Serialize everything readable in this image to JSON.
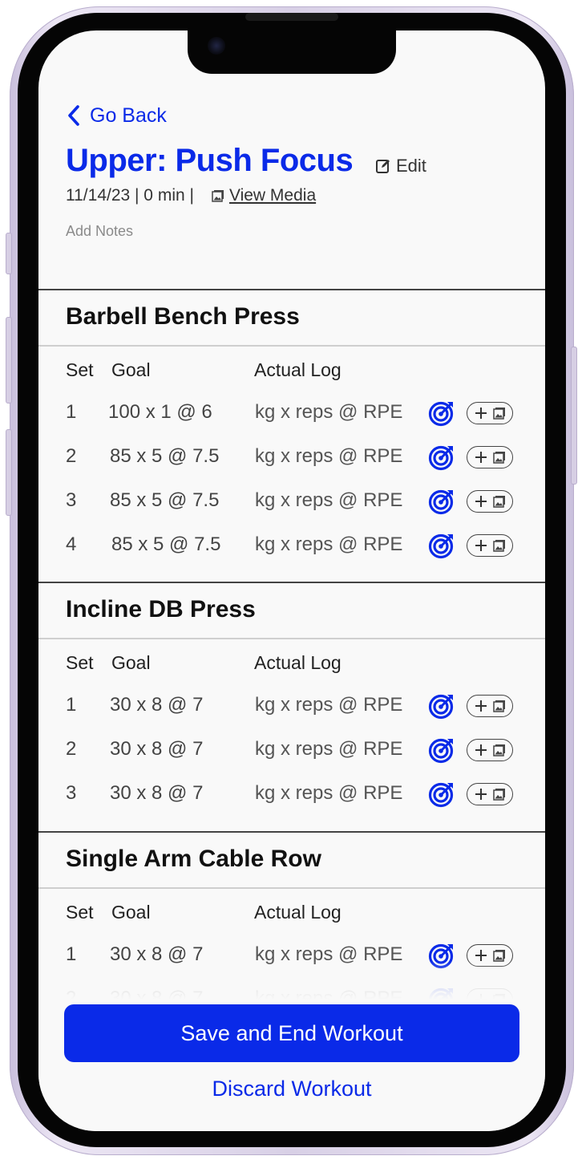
{
  "header": {
    "back_label": "Go Back",
    "title": "Upper: Push Focus",
    "edit_label": "Edit",
    "meta": "11/14/23 | 0 min |",
    "view_media_label": "View Media",
    "notes_placeholder": "Add Notes"
  },
  "columns": {
    "set": "Set",
    "goal": "Goal",
    "actual": "Actual Log"
  },
  "actual_placeholder": "kg x reps @ RPE",
  "exercises": [
    {
      "name": "Barbell Bench Press",
      "sets": [
        {
          "set": "1",
          "goal": "100 x 1 @ 6"
        },
        {
          "set": "2",
          "goal": "85 x 5 @ 7.5"
        },
        {
          "set": "3",
          "goal": "85 x 5 @ 7.5"
        },
        {
          "set": "4",
          "goal": "85 x 5 @ 7.5"
        }
      ]
    },
    {
      "name": "Incline DB Press",
      "sets": [
        {
          "set": "1",
          "goal": "30 x 8 @ 7"
        },
        {
          "set": "2",
          "goal": "30 x 8 @ 7"
        },
        {
          "set": "3",
          "goal": "30 x 8 @ 7"
        }
      ]
    },
    {
      "name": "Single Arm Cable Row",
      "sets": [
        {
          "set": "1",
          "goal": "30 x 8 @ 7"
        },
        {
          "set": "2",
          "goal": "30 x 8 @ 7"
        }
      ]
    }
  ],
  "actions": {
    "save_label": "Save and End Workout",
    "discard_label": "Discard Workout"
  },
  "colors": {
    "accent": "#0a2ae8",
    "text": "#111111",
    "muted": "#8a8a8a",
    "background": "#f9f9f9"
  },
  "icons": {
    "back": "chevron-left-icon",
    "edit": "edit-icon",
    "media": "image-icon",
    "target": "target-icon",
    "add_media": "plus-image-icon"
  }
}
